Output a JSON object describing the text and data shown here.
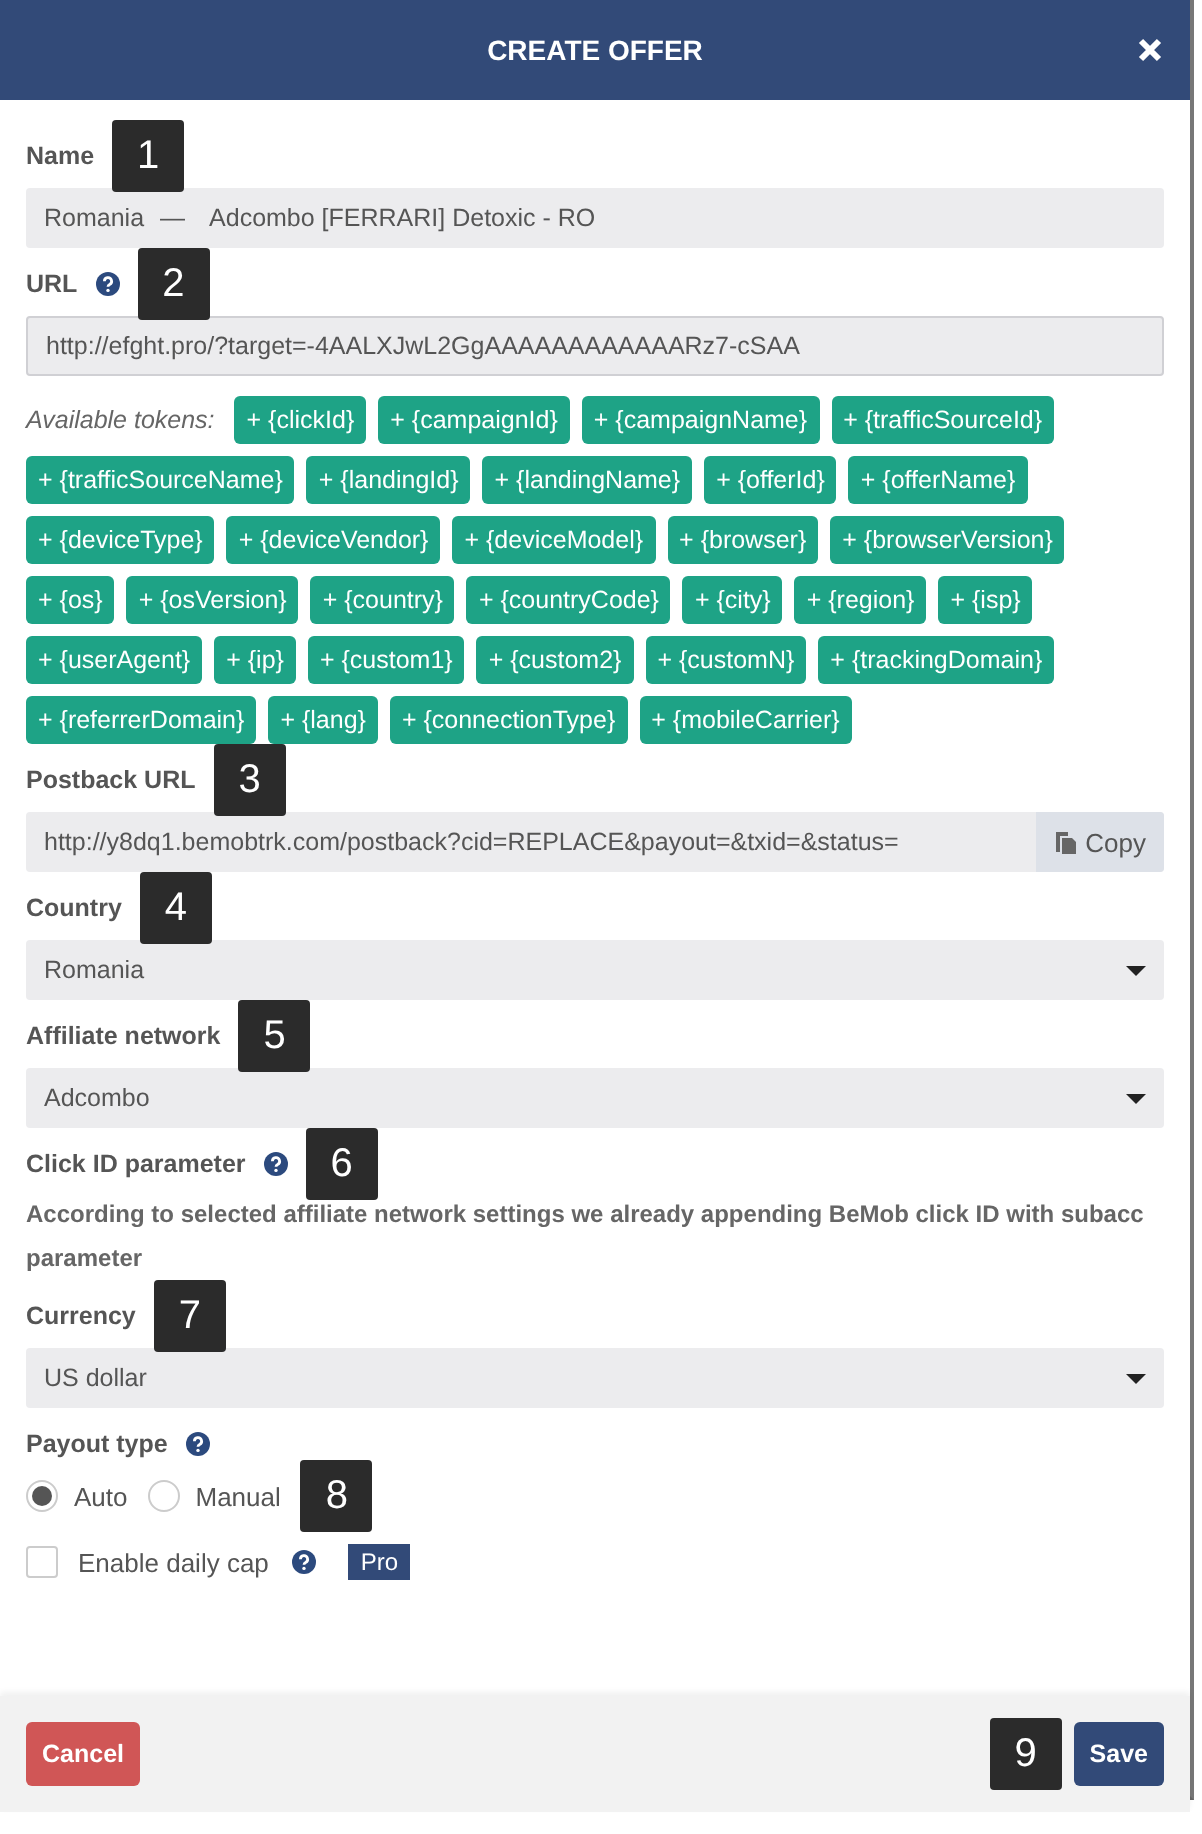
{
  "dialog": {
    "title": "CREATE OFFER"
  },
  "fields": [
    {
      "kind": "name",
      "label": "Name",
      "marker": "1",
      "prefix": "Romania",
      "separator": "—",
      "value": "Adcombo [FERRARI] Detoxic - RO"
    },
    {
      "kind": "text",
      "label": "URL",
      "help": true,
      "marker": "2",
      "value": "http://efght.pro/?target=-4AALXJwL2GgAAAAAAAAAAAARz7-cSAA"
    },
    {
      "kind": "tokens",
      "caption": "Available tokens:",
      "tokens": [
        "+ {clickId}",
        "+ {campaignId}",
        "+ {campaignName}",
        "+ {trafficSourceId}",
        "+ {trafficSourceName}",
        "+ {landingId}",
        "+ {landingName}",
        "+ {offerId}",
        "+ {offerName}",
        "+ {deviceType}",
        "+ {deviceVendor}",
        "+ {deviceModel}",
        "+ {browser}",
        "+ {browserVersion}",
        "+ {os}",
        "+ {osVersion}",
        "+ {country}",
        "+ {countryCode}",
        "+ {city}",
        "+ {region}",
        "+ {isp}",
        "+ {userAgent}",
        "+ {ip}",
        "+ {custom1}",
        "+ {custom2}",
        "+ {customN}",
        "+ {trackingDomain}",
        "+ {referrerDomain}",
        "+ {lang}",
        "+ {connectionType}",
        "+ {mobileCarrier}"
      ]
    },
    {
      "kind": "copy",
      "label": "Postback URL",
      "marker": "3",
      "value": "http://y8dq1.bemobtrk.com/postback?cid=REPLACE&payout=&txid=&status=",
      "button": "Copy"
    },
    {
      "kind": "select",
      "label": "Country",
      "marker": "4",
      "value": "Romania"
    },
    {
      "kind": "select",
      "label": "Affiliate network",
      "marker": "5",
      "value": "Adcombo"
    },
    {
      "kind": "note",
      "label": "Click ID parameter",
      "help": true,
      "marker": "6",
      "text": "According to selected affiliate network settings we already appending BeMob click ID with subacc parameter"
    },
    {
      "kind": "select",
      "label": "Currency",
      "marker": "7",
      "value": "US dollar"
    },
    {
      "kind": "radios",
      "label": "Payout type",
      "help": true,
      "marker": "8",
      "options": [
        {
          "label": "Auto",
          "selected": true
        },
        {
          "label": "Manual",
          "selected": false
        }
      ]
    },
    {
      "kind": "checkbox",
      "label": "Enable daily cap",
      "checked": false,
      "help": true,
      "badge": "Pro"
    }
  ],
  "footer": {
    "cancel": "Cancel",
    "marker": "9",
    "save": "Save"
  }
}
